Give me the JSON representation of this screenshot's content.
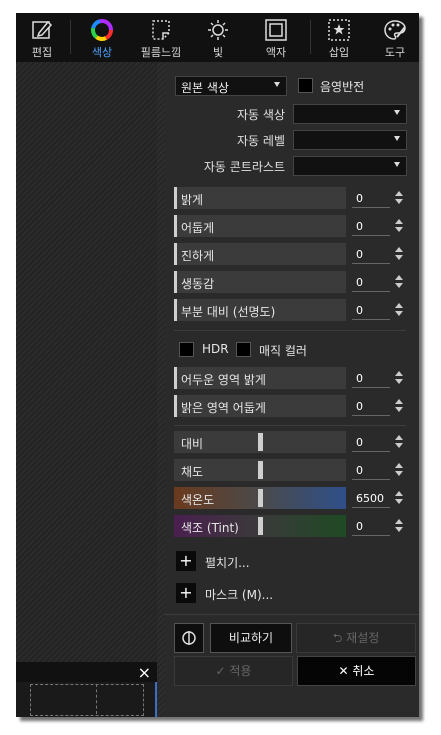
{
  "toolbar": {
    "tools": [
      {
        "label": "편집",
        "icon": "edit-icon"
      },
      {
        "label": "색상",
        "icon": "color-wheel-icon",
        "active": true
      },
      {
        "label": "필름느낌",
        "icon": "film-icon"
      },
      {
        "label": "빛",
        "icon": "sun-icon"
      },
      {
        "label": "액자",
        "icon": "frame-icon"
      },
      {
        "label": "삽입",
        "icon": "insert-icon"
      },
      {
        "label": "도구",
        "icon": "palette-icon"
      }
    ]
  },
  "left": {
    "close_symbol": "×"
  },
  "panel": {
    "mode_select": "원본 색상",
    "negative_label": "음영반전",
    "auto_color_label": "자동 색상",
    "auto_level_label": "자동 레벨",
    "auto_contrast_label": "자동 콘트라스트",
    "sliders_group1": [
      {
        "name": "밝게",
        "value": "0"
      },
      {
        "name": "어둡게",
        "value": "0"
      },
      {
        "name": "진하게",
        "value": "0"
      },
      {
        "name": "생동감",
        "value": "0"
      },
      {
        "name": "부분 대비 (선명도)",
        "value": "0"
      }
    ],
    "hdr_label": "HDR",
    "magic_color_label": "매직 컬러",
    "sliders_group2": [
      {
        "name": "어두운 영역 밝게",
        "value": "0"
      },
      {
        "name": "밝은 영역 어둡게",
        "value": "0"
      }
    ],
    "sliders_group3": [
      {
        "name": "대비",
        "value": "0"
      },
      {
        "name": "채도",
        "value": "0"
      },
      {
        "name": "색온도",
        "value": "6500"
      },
      {
        "name": "색조 (Tint)",
        "value": "0"
      }
    ],
    "expand_label": "펼치기...",
    "mask_label": "마스크 (M)...",
    "compare_label": "비교하기",
    "reset_label": "재설정",
    "apply_label": "적용",
    "cancel_label": "취소"
  },
  "colors": {
    "accent": "#4ea4ff",
    "temperature_gradient": [
      "#6a3a1e",
      "#2f4f8a"
    ],
    "tint_gradient": [
      "#4a1f4f",
      "#1f4a24"
    ]
  }
}
